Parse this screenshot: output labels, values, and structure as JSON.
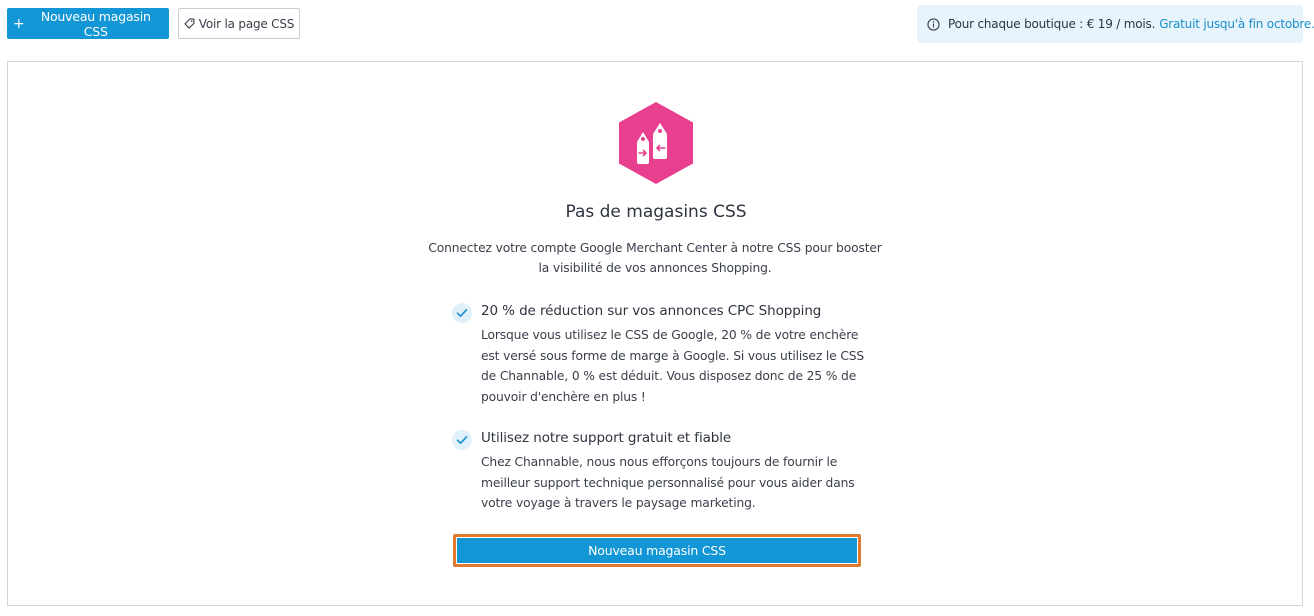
{
  "toolbar": {
    "new_store_plus": "+",
    "new_store_label": "Nouveau magasin CSS",
    "view_page_label": "Voir la page CSS"
  },
  "info_banner": {
    "text": "Pour chaque boutique : € 19 / mois.",
    "link": "Gratuit jusqu'à fin octobre."
  },
  "empty_state": {
    "title": "Pas de magasins CSS",
    "description": "Connectez votre compte Google Merchant Center à notre CSS pour booster la visibilité de vos annonces Shopping.",
    "features": [
      {
        "title": "20 % de réduction sur vos annonces CPC Shopping",
        "body": "Lorsque vous utilisez le CSS de Google, 20 % de votre enchère est versé sous forme de marge à Google. Si vous utilisez le CSS de Channable, 0 % est déduit. Vous disposez donc de 25 % de pouvoir d'enchère en plus !"
      },
      {
        "title": "Utilisez notre support gratuit et fiable",
        "body": "Chez Channable, nous nous efforçons toujours de fournir le meilleur support technique personnalisé pour vous aider dans votre voyage à travers le paysage marketing."
      }
    ],
    "cta_label": "Nouveau magasin CSS"
  },
  "colors": {
    "primary": "#1296d6",
    "brand_pink": "#e8408f",
    "banner_bg": "#e8f4fb",
    "link": "#1a8fd0",
    "highlight": "#e07b2e"
  },
  "icons": {
    "tag": "tag-icon",
    "info": "info-icon",
    "logo": "price-tags-hexagon-icon",
    "check": "check-icon"
  }
}
